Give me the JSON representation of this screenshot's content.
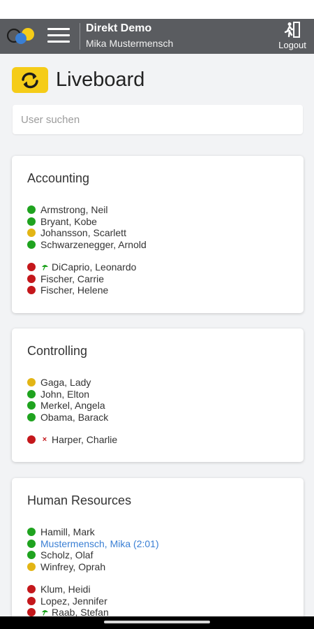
{
  "header": {
    "app_title": "Direkt Demo",
    "user_name": "Mika Mustermensch",
    "logout_label": "Logout",
    "logo_icon": "three-circles-logo",
    "menu_icon": "hamburger-icon",
    "logout_icon": "exit-person-icon"
  },
  "page": {
    "title": "Liveboard",
    "refresh_icon": "refresh-icon"
  },
  "search": {
    "placeholder": "User suchen",
    "value": ""
  },
  "colors": {
    "topbar": "#5a5c60",
    "accent": "#f5cc18",
    "status_green": "#1fa31f",
    "status_yellow": "#e3b515",
    "status_red": "#c4171b",
    "link": "#3a7fd4"
  },
  "departments": [
    {
      "name": "Accounting",
      "present": [
        {
          "name": "Armstrong, Neil",
          "status": "green"
        },
        {
          "name": "Bryant, Kobe",
          "status": "green"
        },
        {
          "name": "Johansson, Scarlett",
          "status": "yellow"
        },
        {
          "name": "Schwarzenegger, Arnold",
          "status": "green"
        }
      ],
      "absent": [
        {
          "name": "DiCaprio, Leonardo",
          "status": "red",
          "marker": "umbrella-icon"
        },
        {
          "name": "Fischer, Carrie",
          "status": "red"
        },
        {
          "name": "Fischer, Helene",
          "status": "red"
        }
      ]
    },
    {
      "name": "Controlling",
      "present": [
        {
          "name": "Gaga, Lady",
          "status": "yellow"
        },
        {
          "name": "John, Elton",
          "status": "green"
        },
        {
          "name": "Merkel, Angela",
          "status": "green"
        },
        {
          "name": "Obama, Barack",
          "status": "green"
        }
      ],
      "absent": [
        {
          "name": "Harper, Charlie",
          "status": "red",
          "marker": "cross-icon"
        }
      ]
    },
    {
      "name": "Human Resources",
      "present": [
        {
          "name": "Hamill, Mark",
          "status": "green"
        },
        {
          "name": "Mustermensch, Mika (2:01)",
          "status": "green",
          "is_current_user": true
        },
        {
          "name": "Scholz, Olaf",
          "status": "green"
        },
        {
          "name": "Winfrey, Oprah",
          "status": "yellow"
        }
      ],
      "absent": [
        {
          "name": "Klum, Heidi",
          "status": "red"
        },
        {
          "name": "Lopez, Jennifer",
          "status": "red"
        },
        {
          "name": "Raab, Stefan",
          "status": "red",
          "marker": "umbrella-icon"
        }
      ]
    }
  ]
}
